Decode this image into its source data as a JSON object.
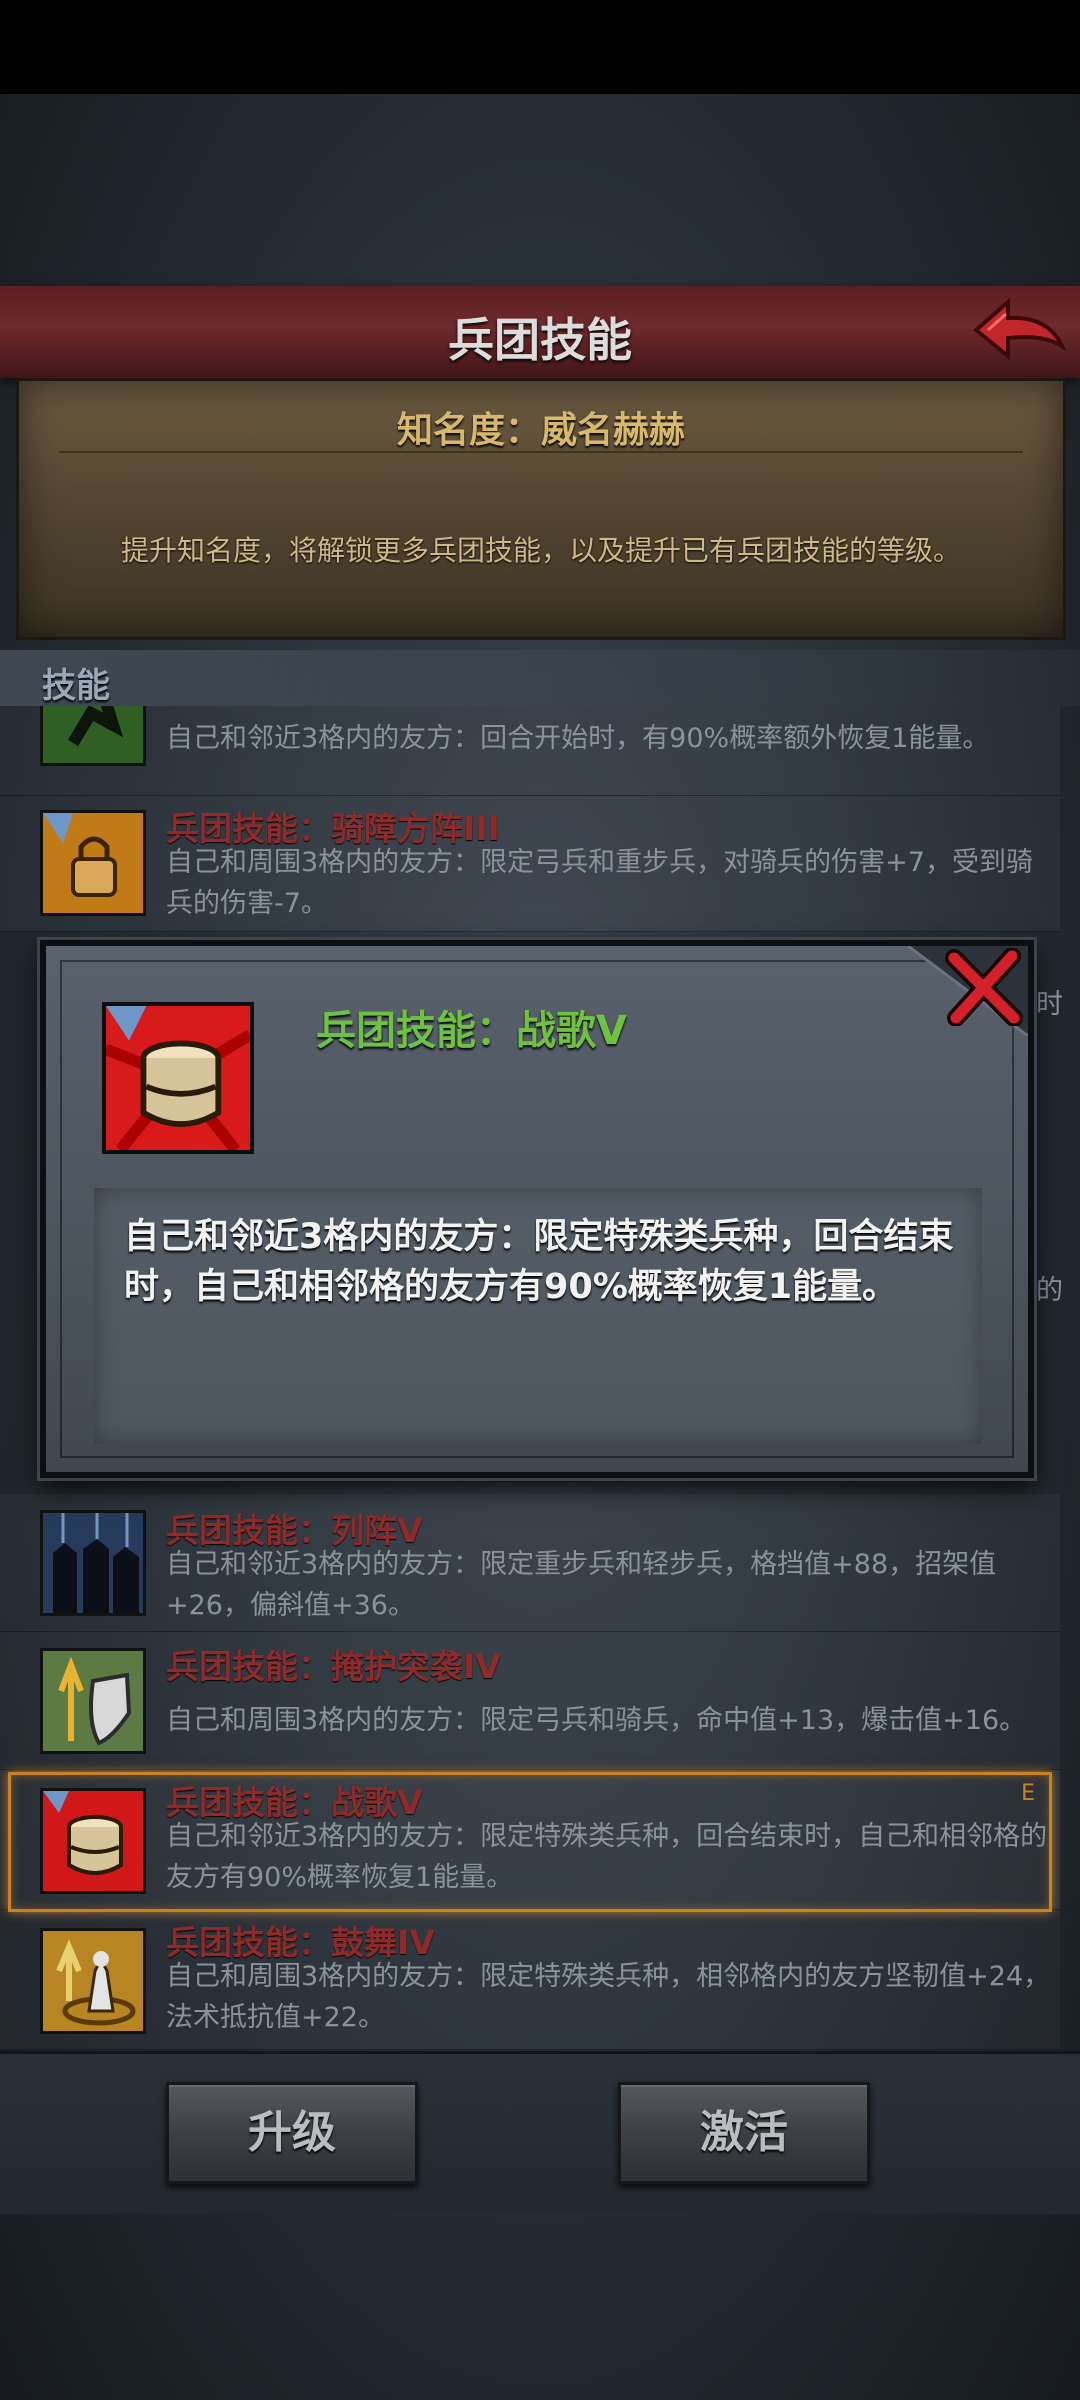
{
  "header": {
    "title": "兵团技能"
  },
  "fame": {
    "title": "知名度：威名赫赫",
    "description": "提升知名度，将解锁更多兵团技能，以及提升已有兵团技能的等级。"
  },
  "section": {
    "label": "技能"
  },
  "skills": [
    {
      "name": "",
      "desc": "自己和邻近3格内的友方：回合开始时，有90%概率额外恢复1能量。",
      "icon": "running-figure-icon"
    },
    {
      "name": "兵团技能：骑障方阵III",
      "desc": "自己和周围3格内的友方：限定弓兵和重步兵，对骑兵的伤害+7，受到骑兵的伤害-7。",
      "icon": "padlock-shield-icon"
    },
    {
      "name": "兵团技能：列阵V",
      "desc": "自己和邻近3格内的友方：限定重步兵和轻步兵，格挡值+88，招架值+26，偏斜值+36。",
      "icon": "soldiers-formation-icon"
    },
    {
      "name": "兵团技能：掩护突袭IV",
      "desc": "自己和周围3格内的友方：限定弓兵和骑兵，命中值+13，爆击值+16。",
      "icon": "shield-arrow-icon"
    },
    {
      "name": "兵团技能：战歌V",
      "desc": "自己和邻近3格内的友方：限定特殊类兵种，回合结束时，自己和相邻格的友方有90%概率恢复1能量。",
      "icon": "war-drum-icon"
    },
    {
      "name": "兵团技能：鼓舞IV",
      "desc": "自己和周围3格内的友方：限定特殊类兵种，相邻格内的友方坚韧值+24，法术抵抗值+22。",
      "icon": "inspire-figure-icon"
    }
  ],
  "side_fragments": [
    "时",
    "的"
  ],
  "selected_marker": "E",
  "buttons": {
    "upgrade": "升级",
    "activate": "激活"
  },
  "modal": {
    "title": "兵团技能：战歌V",
    "description": "自己和邻近3格内的友方：限定特殊类兵种，回合结束时，自己和相邻格的友方有90%概率恢复1能量。",
    "icon": "war-drum-icon"
  },
  "colors": {
    "title_bar": "#6e2a2c",
    "skill_name": "#8e2a2a",
    "modal_title": "#6fc240",
    "selected_frame": "#c9821e",
    "fame_title": "#d8b86a"
  }
}
